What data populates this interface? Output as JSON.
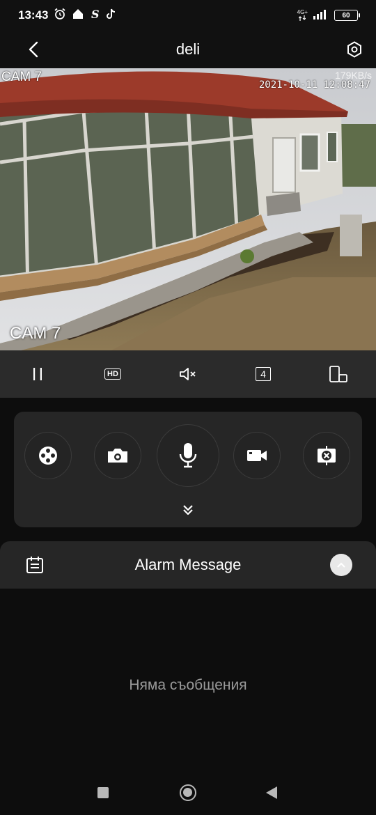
{
  "status_bar": {
    "time": "13:43",
    "network": "4G+",
    "battery": "60",
    "icons": [
      "alarm-clock-icon",
      "home-icon",
      "s-app-icon",
      "tiktok-icon",
      "signal-icon",
      "battery-icon"
    ]
  },
  "header": {
    "title": "deli",
    "back_icon": "chevron-left-icon",
    "settings_icon": "settings-icon"
  },
  "camera": {
    "label_top": "CAM 7",
    "timestamp": "2021-10-11 12:08:47",
    "bitrate": "179KB/s",
    "label_bottom": "CAM 7"
  },
  "controls": {
    "hd_label": "HD",
    "speed_label": "4",
    "icons": [
      "pause-icon",
      "hd-icon",
      "mute-icon",
      "split-screen-icon",
      "rotate-device-icon"
    ]
  },
  "actions": {
    "icons": [
      "ptz-joystick-icon",
      "snapshot-camera-icon",
      "microphone-icon",
      "record-video-icon",
      "fisheye-icon"
    ],
    "expand_icon": "double-chevron-down-icon"
  },
  "alarm": {
    "title": "Alarm Message",
    "calendar_icon": "calendar-icon",
    "toggle_icon": "chevron-up-icon",
    "empty_text": "Няма съобщения"
  },
  "nav": {
    "icons": [
      "recent-apps-icon",
      "home-circle-icon",
      "back-triangle-icon"
    ]
  },
  "colors": {
    "background": "#0d0d0d",
    "panel": "#262626",
    "controls_bar": "#2b2b2b",
    "muted_text": "#9a9a9a"
  }
}
